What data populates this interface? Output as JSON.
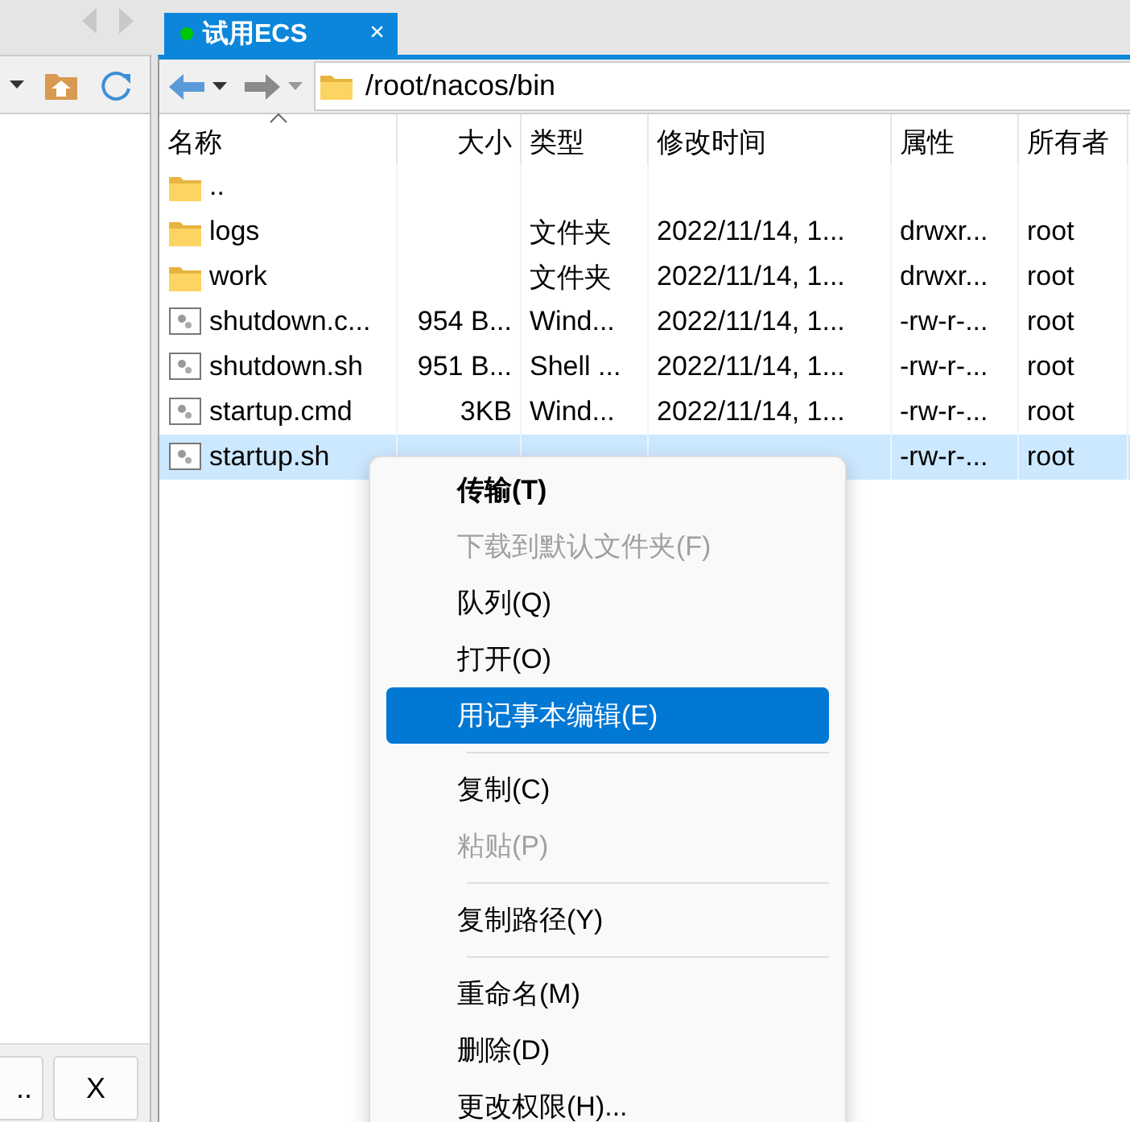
{
  "tab": {
    "title": "试用ECS",
    "connected": true,
    "close": "×"
  },
  "left_pane": {
    "buttons": [
      "..",
      "X"
    ]
  },
  "address_bar": {
    "path": "/root/nacos/bin"
  },
  "file_list": {
    "columns": [
      {
        "label": "名称",
        "sorted": true
      },
      {
        "label": "大小",
        "sorted": false
      },
      {
        "label": "类型",
        "sorted": false
      },
      {
        "label": "修改时间",
        "sorted": false
      },
      {
        "label": "属性",
        "sorted": false
      },
      {
        "label": "所有者",
        "sorted": false
      }
    ],
    "rows": [
      {
        "kind": "folder",
        "name": "..",
        "selected": false
      },
      {
        "kind": "folder",
        "name": "logs",
        "type": "文件夹",
        "modified": "2022/11/14, 1...",
        "permissions": "drwxr...",
        "owner": "root",
        "selected": false
      },
      {
        "kind": "folder",
        "name": "work",
        "type": "文件夹",
        "modified": "2022/11/14, 1...",
        "permissions": "drwxr...",
        "owner": "root",
        "selected": false
      },
      {
        "kind": "file",
        "name": "shutdown.c...",
        "size": "954 B...",
        "type": "Wind...",
        "modified": "2022/11/14, 1...",
        "permissions": "-rw-r-...",
        "owner": "root",
        "selected": false
      },
      {
        "kind": "file",
        "name": "shutdown.sh",
        "size": "951 B...",
        "type": "Shell ...",
        "modified": "2022/11/14, 1...",
        "permissions": "-rw-r-...",
        "owner": "root",
        "selected": false
      },
      {
        "kind": "file",
        "name": "startup.cmd",
        "size": "3KB",
        "type": "Wind...",
        "modified": "2022/11/14, 1...",
        "permissions": "-rw-r-...",
        "owner": "root",
        "selected": false
      },
      {
        "kind": "file",
        "name": "startup.sh",
        "permissions": "-rw-r-...",
        "owner": "root",
        "selected": true
      }
    ]
  },
  "context_menu": {
    "items": [
      {
        "kind": "item",
        "label": "传输(T)",
        "default": true,
        "disabled": false,
        "selected": false
      },
      {
        "kind": "item",
        "label": "下载到默认文件夹(F)",
        "default": false,
        "disabled": true,
        "selected": false
      },
      {
        "kind": "item",
        "label": "队列(Q)",
        "default": false,
        "disabled": false,
        "selected": false
      },
      {
        "kind": "item",
        "label": "打开(O)",
        "default": false,
        "disabled": false,
        "selected": false
      },
      {
        "kind": "item",
        "label": "用记事本编辑(E)",
        "default": false,
        "disabled": false,
        "selected": true
      },
      {
        "kind": "separator"
      },
      {
        "kind": "item",
        "label": "复制(C)",
        "default": false,
        "disabled": false,
        "selected": false
      },
      {
        "kind": "item",
        "label": "粘贴(P)",
        "default": false,
        "disabled": true,
        "selected": false
      },
      {
        "kind": "separator"
      },
      {
        "kind": "item",
        "label": "复制路径(Y)",
        "default": false,
        "disabled": false,
        "selected": false
      },
      {
        "kind": "separator"
      },
      {
        "kind": "item",
        "label": "重命名(M)",
        "default": false,
        "disabled": false,
        "selected": false
      },
      {
        "kind": "item",
        "label": "删除(D)",
        "default": false,
        "disabled": false,
        "selected": false
      },
      {
        "kind": "item",
        "label": "更改权限(H)...",
        "default": false,
        "disabled": false,
        "selected": false
      }
    ]
  }
}
